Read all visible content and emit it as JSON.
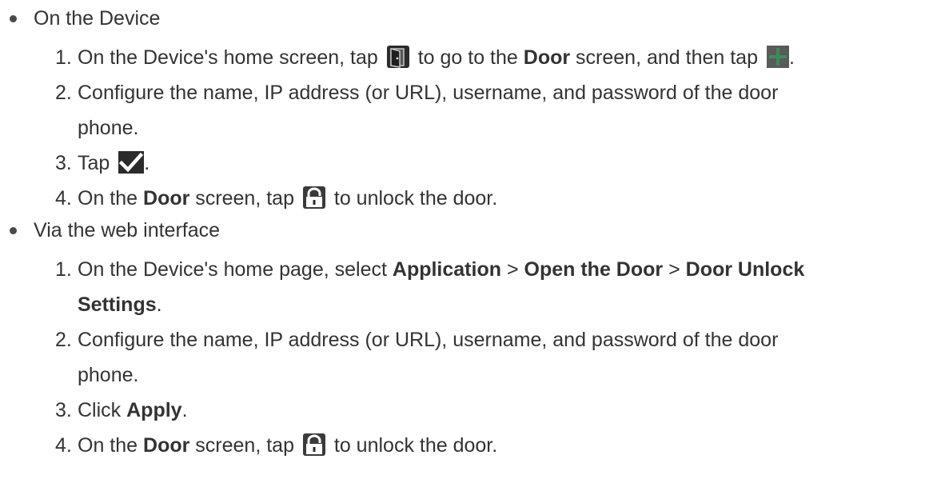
{
  "sections": [
    {
      "title": "On the Device",
      "steps": [
        {
          "num": "1.",
          "pre": "On the Device's home screen, tap",
          "mid": "to go to the",
          "bold": "Door",
          "mid2": "screen, and then tap",
          "end": ".",
          "icons": [
            "door-icon",
            "add-icon"
          ]
        },
        {
          "num": "2.",
          "line1": "Configure the name, IP address (or URL), username, and password of the door",
          "line2": "phone."
        },
        {
          "num": "3.",
          "pre": "Tap",
          "end": ".",
          "icons": [
            "checkmark-icon"
          ]
        },
        {
          "num": "4.",
          "pre": "On the",
          "bold": "Door",
          "mid": "screen, tap",
          "end": "to unlock the door.",
          "icons": [
            "unlock-icon"
          ]
        }
      ]
    },
    {
      "title": "Via the web interface",
      "steps": [
        {
          "num": "1.",
          "pre": "On the Device's home page, select",
          "bold1": "Application",
          "sep1": ">",
          "bold2": "Open the Door",
          "sep2": ">",
          "bold3": "Door Unlock",
          "bold4": "Settings",
          "end": "."
        },
        {
          "num": "2.",
          "line1": "Configure the name, IP address (or URL), username, and password of the door",
          "line2": "phone."
        },
        {
          "num": "3.",
          "pre": "Click",
          "bold": "Apply",
          "end": "."
        },
        {
          "num": "4.",
          "pre": "On the",
          "bold": "Door",
          "mid": "screen, tap",
          "end": "to unlock the door.",
          "icons": [
            "unlock-icon"
          ]
        }
      ]
    }
  ],
  "colors": {
    "text": "#333333",
    "icon_dark": "#2b2b2b",
    "icon_mid": "#555555",
    "add_green": "#3c8c5a"
  }
}
